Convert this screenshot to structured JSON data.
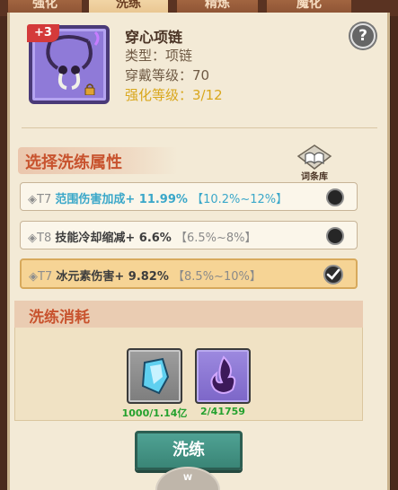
{
  "tabs": [
    {
      "label": "强化"
    },
    {
      "label": "洗练"
    },
    {
      "label": "精炼"
    },
    {
      "label": "魔化"
    }
  ],
  "item": {
    "plus_level": "+3",
    "name": "穿心项链",
    "type_line": "类型：项链",
    "level_line": "穿戴等级：70",
    "enhance_line": "强化等级：3/12"
  },
  "help_label": "?",
  "refine_select": {
    "title": "选择洗练属性",
    "dict_label": "词条库",
    "attributes": [
      {
        "tier": "◈T7",
        "text": "范围伤害加成+ 11.99%",
        "range": "【10.2%~12%】",
        "style": "blue",
        "selected": false
      },
      {
        "tier": "◈T8",
        "text": "技能冷却缩减+ 6.6%",
        "range": "【6.5%~8%】",
        "style": "normal",
        "selected": false
      },
      {
        "tier": "◈T7",
        "text": "冰元素伤害+ 9.82%",
        "range": "【8.5%~10%】",
        "style": "normal",
        "selected": true
      }
    ]
  },
  "cost": {
    "title": "洗练消耗",
    "materials": [
      {
        "icon": "crystal-shard-icon",
        "count": "1000/1.14亿"
      },
      {
        "icon": "purple-flame-icon",
        "count": "2/41759"
      }
    ]
  },
  "refine_button_label": "洗练",
  "bottom_indicator": "W"
}
